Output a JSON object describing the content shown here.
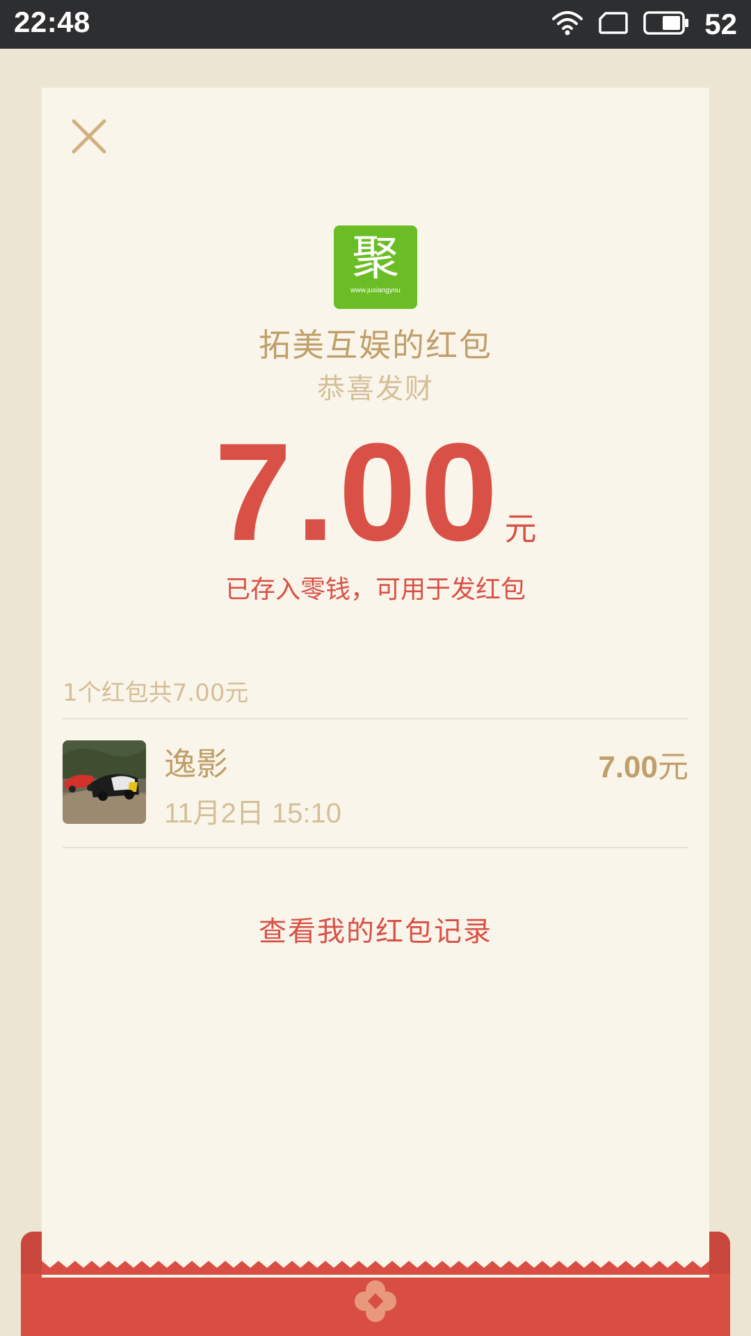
{
  "status_bar": {
    "time": "22:48",
    "battery_level": "52",
    "icons": [
      "wifi-icon",
      "sim-icon",
      "battery-icon"
    ]
  },
  "red_packet": {
    "close_icon": "close-icon",
    "logo": {
      "char": "聚",
      "url": "www.juxiangyou",
      "color": "#6abd24"
    },
    "sender_title": "拓美互娱的红包",
    "greeting": "恭喜发财",
    "amount": "7.00",
    "amount_unit": "元",
    "saved_note": "已存入零钱，可用于发红包",
    "summary": "1个红包共7.00元",
    "records": [
      {
        "name": "逸影",
        "time": "11月2日  15:10",
        "amount": "7.00",
        "unit": "元"
      }
    ],
    "history_link": "查看我的红包记录"
  },
  "colors": {
    "accent_red": "#d95046",
    "gold_text": "#bf9f6b",
    "muted_gold": "#d3bf98",
    "card_bg": "#faf5ea",
    "page_bg": "#ede5d3",
    "envelope_red": "#d84e42"
  }
}
